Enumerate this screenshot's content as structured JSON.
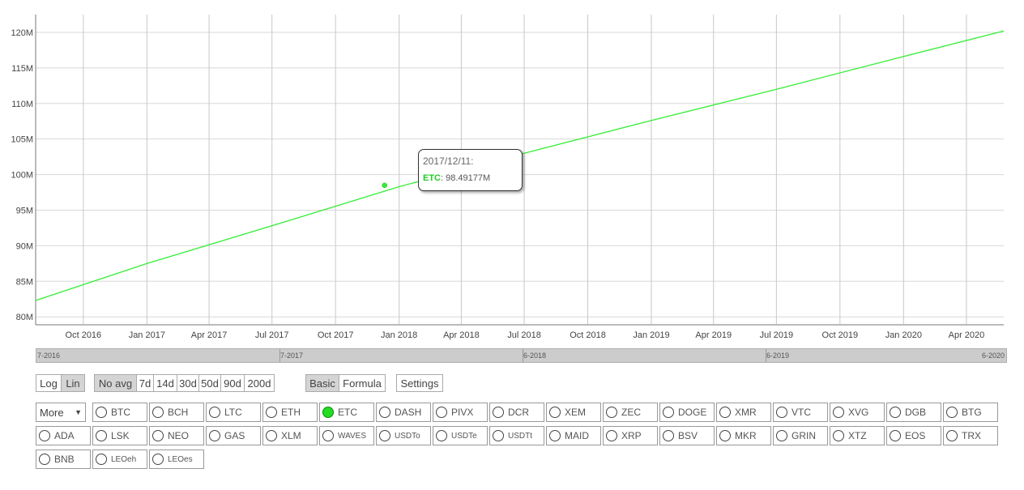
{
  "chart_data": {
    "type": "line",
    "title": "",
    "xlabel": "",
    "ylabel": "",
    "series": [
      {
        "name": "ETC",
        "color": "#33ee33",
        "x": [
          "2016-07-24",
          "2017-01-01",
          "2017-07-01",
          "2018-01-01",
          "2018-07-01",
          "2019-01-01",
          "2019-07-01",
          "2020-01-01",
          "2020-05-25"
        ],
        "y": [
          82.3,
          87.5,
          92.8,
          98.3,
          103.0,
          107.6,
          112.0,
          116.6,
          120.2
        ]
      }
    ],
    "x_tick_labels": [
      "Oct 2016",
      "Jan 2017",
      "Apr 2017",
      "Jul 2017",
      "Oct 2017",
      "Jan 2018",
      "Apr 2018",
      "Jul 2018",
      "Oct 2018",
      "Jan 2019",
      "Apr 2019",
      "Jul 2019",
      "Oct 2019",
      "Jan 2020",
      "Apr 2020"
    ],
    "x_tick_dates": [
      "2016-10-01",
      "2017-01-01",
      "2017-04-01",
      "2017-07-01",
      "2017-10-01",
      "2018-01-01",
      "2018-04-01",
      "2018-07-01",
      "2018-10-01",
      "2019-01-01",
      "2019-04-01",
      "2019-07-01",
      "2019-10-01",
      "2020-01-01",
      "2020-04-01"
    ],
    "xlim": [
      "2016-07-24",
      "2020-05-25"
    ],
    "y_ticks": [
      80,
      85,
      90,
      95,
      100,
      105,
      110,
      115,
      120
    ],
    "y_tick_labels": [
      "80M",
      "85M",
      "90M",
      "95M",
      "100M",
      "105M",
      "110M",
      "115M",
      "120M"
    ],
    "ylim": [
      79,
      122.5
    ],
    "y_scale": "linear",
    "grid": true,
    "highlight_point": {
      "x": "2017-12-11",
      "y": 98.49177
    },
    "tooltip": {
      "date": "2017/12/11:",
      "series": "ETC",
      "value": "98.49177M"
    }
  },
  "navigator": {
    "labels": [
      "7-2016",
      "7-2017",
      "6-2018",
      "6-2019",
      "6-2020"
    ]
  },
  "controls": {
    "scale": [
      {
        "label": "Log",
        "active": false
      },
      {
        "label": "Lin",
        "active": true
      }
    ],
    "averages": [
      {
        "label": "No avg",
        "active": true
      },
      {
        "label": "7d",
        "active": false
      },
      {
        "label": "14d",
        "active": false
      },
      {
        "label": "30d",
        "active": false
      },
      {
        "label": "50d",
        "active": false
      },
      {
        "label": "90d",
        "active": false
      },
      {
        "label": "200d",
        "active": false
      }
    ],
    "modes": [
      {
        "label": "Basic",
        "active": true
      },
      {
        "label": "Formula",
        "active": false
      }
    ],
    "settings": "Settings",
    "more": "More",
    "more_arrow": "▼"
  },
  "coins": {
    "row1": [
      {
        "label": "BTC"
      },
      {
        "label": "BCH"
      },
      {
        "label": "LTC"
      },
      {
        "label": "ETH"
      },
      {
        "label": "ETC",
        "selected": true
      },
      {
        "label": "DASH"
      },
      {
        "label": "PIVX"
      },
      {
        "label": "DCR"
      },
      {
        "label": "XEM"
      },
      {
        "label": "ZEC"
      },
      {
        "label": "DOGE"
      },
      {
        "label": "XMR"
      },
      {
        "label": "VTC"
      },
      {
        "label": "XVG"
      },
      {
        "label": "DGB"
      },
      {
        "label": "BTG"
      }
    ],
    "row2": [
      {
        "label": "ADA"
      },
      {
        "label": "LSK"
      },
      {
        "label": "NEO"
      },
      {
        "label": "GAS"
      },
      {
        "label": "XLM"
      },
      {
        "label": "WAVES",
        "small": true
      },
      {
        "label": "USDTo",
        "small": true
      },
      {
        "label": "USDTe",
        "small": true
      },
      {
        "label": "USDTt",
        "small": true
      },
      {
        "label": "MAID"
      },
      {
        "label": "XRP"
      },
      {
        "label": "BSV"
      },
      {
        "label": "MKR"
      },
      {
        "label": "GRIN"
      },
      {
        "label": "XTZ"
      },
      {
        "label": "EOS"
      },
      {
        "label": "TRX"
      }
    ],
    "row3": [
      {
        "label": "BNB"
      },
      {
        "label": "LEOeh",
        "small": true
      },
      {
        "label": "LEOes",
        "small": true
      }
    ]
  }
}
